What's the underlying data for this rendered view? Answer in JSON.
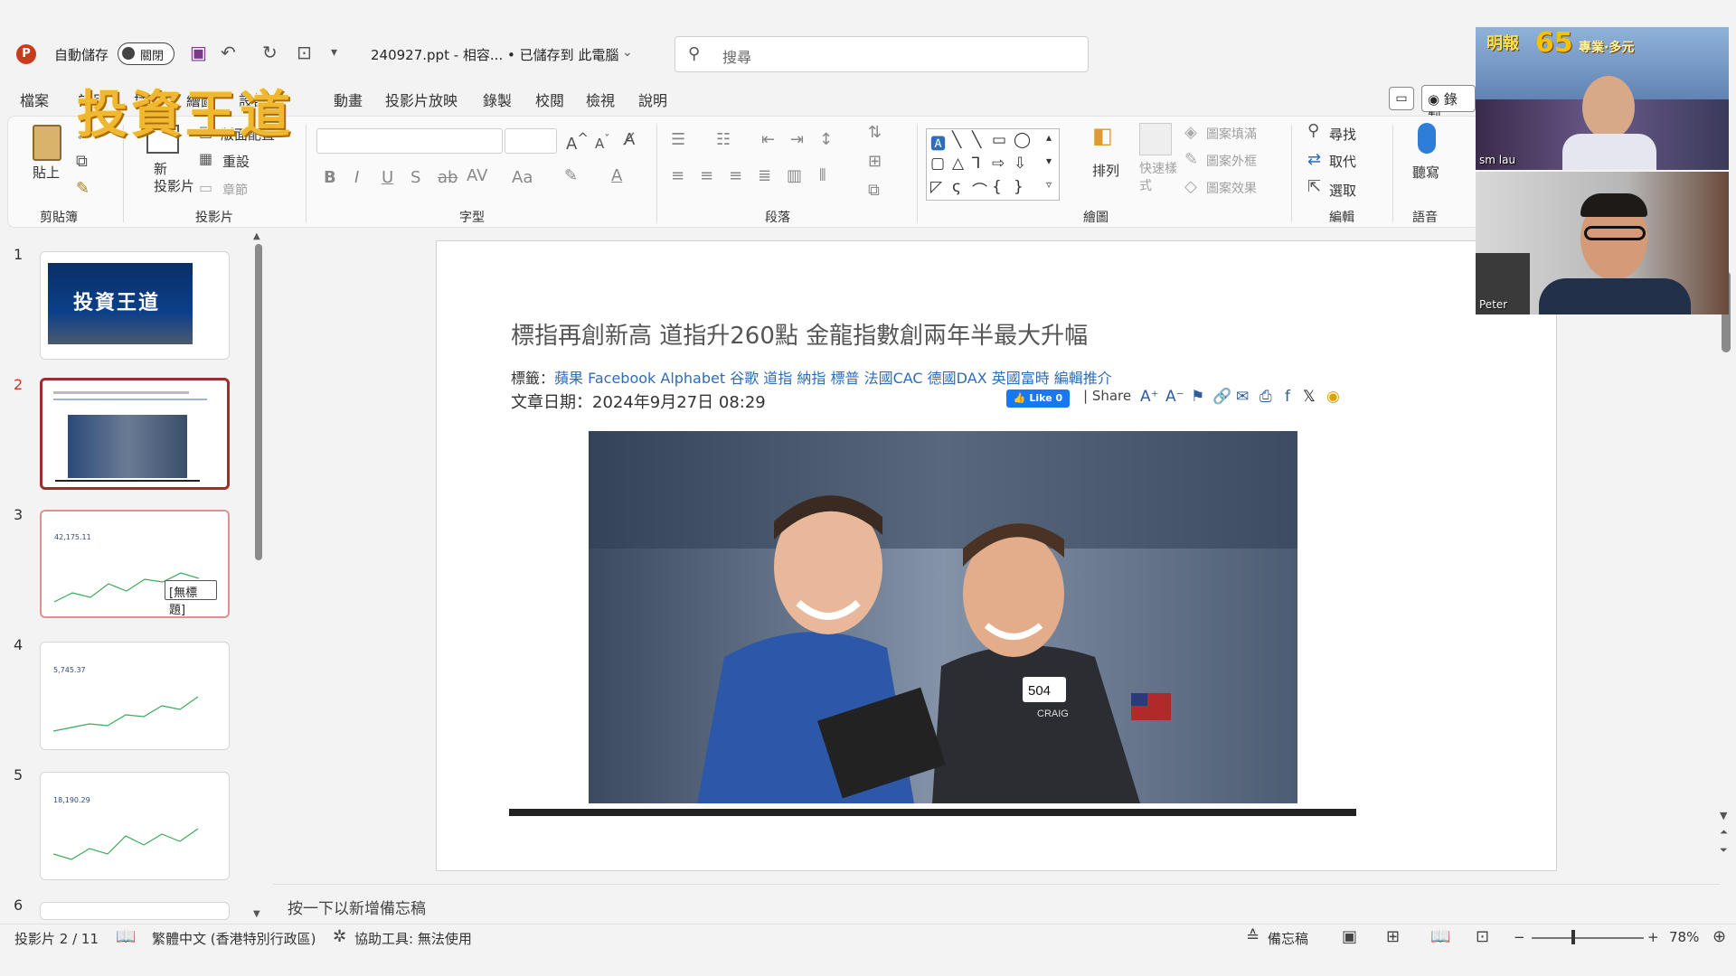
{
  "titlebar": {
    "app_icon": "P",
    "autosave_label": "自動儲存",
    "autosave_state": "關閉",
    "filename": "240927.ppt  -  相容...  • 已儲存到 此電腦",
    "search_placeholder": "搜尋"
  },
  "menu": {
    "items": [
      "檔案",
      "常用",
      "插入",
      "繪圖",
      "設計",
      "動畫",
      "投影片放映",
      "錄製",
      "校閱",
      "檢視",
      "說明"
    ],
    "record_label": "錄製"
  },
  "overlay_logo": "投資王道",
  "ribbon": {
    "clipboard": {
      "paste": "貼上",
      "label": "剪貼簿"
    },
    "slides": {
      "new_slide": "新\n投影片",
      "layout": "版面配置",
      "reset": "重設",
      "section": "章節",
      "label": "投影片"
    },
    "font": {
      "label": "字型",
      "bold": "B",
      "italic": "I",
      "underline": "U",
      "strike": "S",
      "case": "Aa"
    },
    "paragraph": {
      "label": "段落"
    },
    "drawing": {
      "arrange": "排列",
      "quick_styles": "快速樣\n式",
      "fill": "圖案填滿",
      "outline": "圖案外框",
      "effects": "圖案效果",
      "label": "繪圖"
    },
    "editing": {
      "find": "尋找",
      "replace": "取代",
      "select": "選取",
      "label": "編輯"
    },
    "voice": {
      "dictate": "聽寫",
      "label": "語音"
    }
  },
  "slides_panel": {
    "numbers": [
      "1",
      "2",
      "3",
      "4",
      "5",
      "6"
    ],
    "tooltip": "[無標題]",
    "thumb3_value": "42,175.11",
    "thumb4_value": "5,745.37",
    "thumb5_value": "18,190.29"
  },
  "slide": {
    "title": "標指再創新高 道指升260點 金龍指數創兩年半最大升幅",
    "tags_prefix": "標籤：",
    "tags": "蘋果 Facebook Alphabet 谷歌 道指 納指 標普 法國CAC 德國DAX 英國富時 編輯推介",
    "date": "文章日期：2024年9月27日 08:29",
    "like": "Like 0",
    "share": "| Share",
    "photo_badge": "504",
    "photo_name": "CRAIG"
  },
  "notes": {
    "placeholder": "按一下以新增備忘稿"
  },
  "status": {
    "slide_count": "投影片 2 / 11",
    "language": "繁體中文 (香港特別行政區)",
    "accessibility": "協助工具: 無法使用",
    "notes_btn": "備忘稿",
    "zoom": "78%"
  },
  "video": {
    "top_name": "sm lau",
    "bottom_name": "Peter",
    "banner": "明報",
    "banner_num": "65",
    "banner_sub": "專業·多元"
  }
}
